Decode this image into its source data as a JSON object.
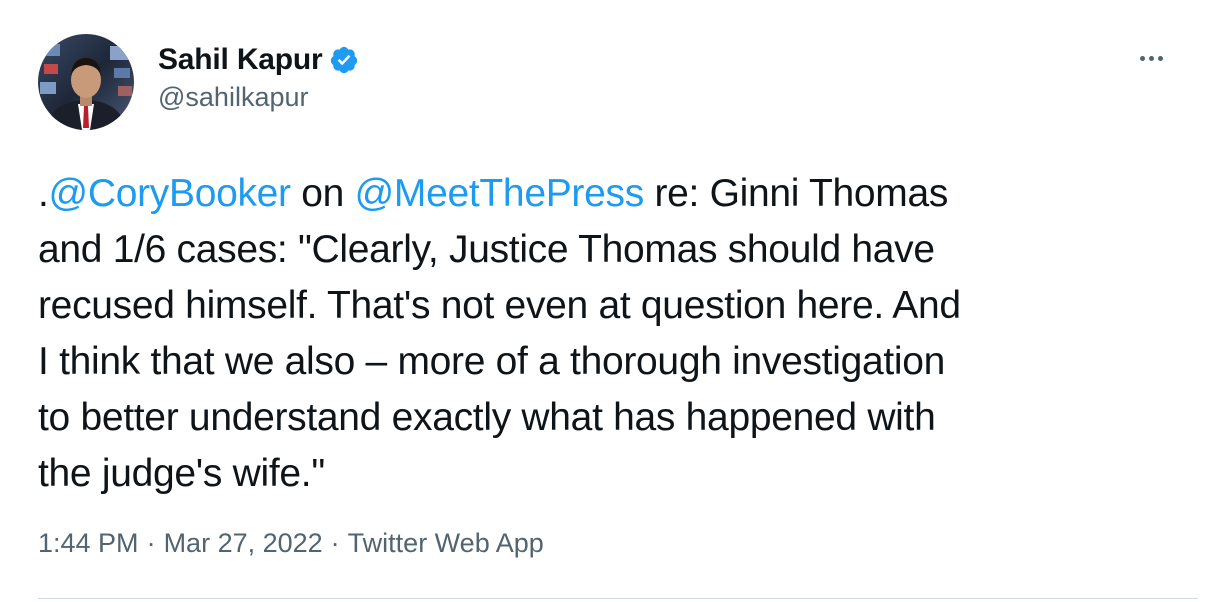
{
  "author": {
    "display_name": "Sahil Kapur",
    "handle": "@sahilkapur",
    "verified_icon": "verified-badge-icon",
    "avatar_icon": "profile-photo"
  },
  "more_menu_icon": "more-horizontal-icon",
  "tweet": {
    "segments": [
      {
        "line": 0,
        "parts": [
          {
            "text": ".",
            "type": "text"
          },
          {
            "text": "@CoryBooker",
            "type": "mention"
          },
          {
            "text": " on ",
            "type": "text"
          },
          {
            "text": "@MeetThePress",
            "type": "mention"
          },
          {
            "text": " re: Ginni Thomas",
            "type": "text"
          }
        ]
      },
      {
        "line": 1,
        "text": "and 1/6 cases: \"Clearly, Justice Thomas should have"
      },
      {
        "line": 2,
        "text": "recused himself. That's not even at question here. And"
      },
      {
        "line": 3,
        "text": "I think that we also – more of a thorough investigation"
      },
      {
        "line": 4,
        "text": "to better understand exactly what has happened with"
      },
      {
        "line": 5,
        "text": "the judge's wife.\""
      }
    ]
  },
  "meta": {
    "time": "1:44 PM",
    "date": "Mar 27, 2022",
    "source": "Twitter Web App",
    "separator": "·"
  },
  "colors": {
    "link": "#1d9bf0",
    "secondary_text": "#536471",
    "primary_text": "#0f1419",
    "divider": "#cfd9de"
  }
}
